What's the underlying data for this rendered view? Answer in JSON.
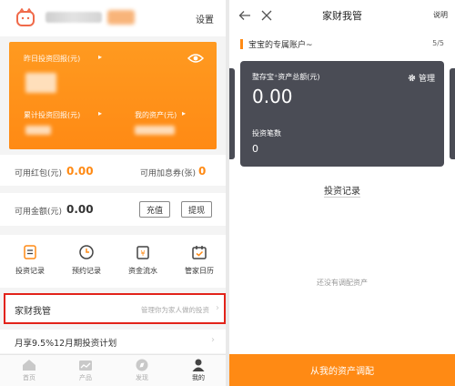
{
  "left": {
    "header": {
      "settings_label": "设置"
    },
    "card": {
      "yesterday_label": "昨日投资回报(元)",
      "cumulative_label": "累计投资回报(元)",
      "assets_label": "我的资产(元)"
    },
    "red_packet": {
      "label": "可用红包(元)",
      "value": "0.00"
    },
    "coupon": {
      "label": "可用加息券(张)",
      "value": "0"
    },
    "balance": {
      "label": "可用金额(元)",
      "value": "0.00"
    },
    "recharge_label": "充值",
    "withdraw_label": "提现",
    "quick_actions": [
      {
        "label": "投资记录",
        "icon": "clipboard-icon"
      },
      {
        "label": "预约记录",
        "icon": "clock-icon"
      },
      {
        "label": "资金流水",
        "icon": "money-flow-icon"
      },
      {
        "label": "管家日历",
        "icon": "calendar-icon"
      }
    ],
    "family_manager": {
      "title": "家财我管",
      "desc": "管理你为家人做的投资"
    },
    "plan_text": "月享9.5%12月期投资计划",
    "tabs": [
      {
        "label": "首页",
        "icon": "home-icon"
      },
      {
        "label": "产品",
        "icon": "product-icon"
      },
      {
        "label": "发现",
        "icon": "discover-icon"
      },
      {
        "label": "我的",
        "icon": "user-icon"
      }
    ]
  },
  "right": {
    "title": "家财我管",
    "explain_label": "说明",
    "account_title": "宝宝的专属账户~",
    "pager": "5/5",
    "card": {
      "total_label": "整存宝⁺资产总额(元)",
      "total_value": "0.00",
      "manage_label": "管理",
      "count_label": "投资笔数",
      "count_value": "0"
    },
    "records_title": "投资记录",
    "empty_text": "还没有调配资产",
    "bottom_button": "从我的资产调配"
  },
  "colors": {
    "accent": "#ff8a14",
    "dark_card": "#4a4c55",
    "highlight": "#e2231a"
  }
}
